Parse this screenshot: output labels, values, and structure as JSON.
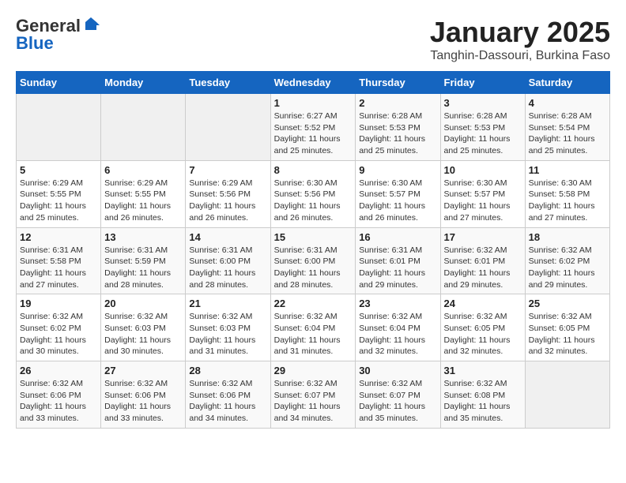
{
  "header": {
    "logo_general": "General",
    "logo_blue": "Blue",
    "month_title": "January 2025",
    "location": "Tanghin-Dassouri, Burkina Faso"
  },
  "days_of_week": [
    "Sunday",
    "Monday",
    "Tuesday",
    "Wednesday",
    "Thursday",
    "Friday",
    "Saturday"
  ],
  "weeks": [
    [
      {
        "day": "",
        "info": ""
      },
      {
        "day": "",
        "info": ""
      },
      {
        "day": "",
        "info": ""
      },
      {
        "day": "1",
        "info": "Sunrise: 6:27 AM\nSunset: 5:52 PM\nDaylight: 11 hours and 25 minutes."
      },
      {
        "day": "2",
        "info": "Sunrise: 6:28 AM\nSunset: 5:53 PM\nDaylight: 11 hours and 25 minutes."
      },
      {
        "day": "3",
        "info": "Sunrise: 6:28 AM\nSunset: 5:53 PM\nDaylight: 11 hours and 25 minutes."
      },
      {
        "day": "4",
        "info": "Sunrise: 6:28 AM\nSunset: 5:54 PM\nDaylight: 11 hours and 25 minutes."
      }
    ],
    [
      {
        "day": "5",
        "info": "Sunrise: 6:29 AM\nSunset: 5:55 PM\nDaylight: 11 hours and 25 minutes."
      },
      {
        "day": "6",
        "info": "Sunrise: 6:29 AM\nSunset: 5:55 PM\nDaylight: 11 hours and 26 minutes."
      },
      {
        "day": "7",
        "info": "Sunrise: 6:29 AM\nSunset: 5:56 PM\nDaylight: 11 hours and 26 minutes."
      },
      {
        "day": "8",
        "info": "Sunrise: 6:30 AM\nSunset: 5:56 PM\nDaylight: 11 hours and 26 minutes."
      },
      {
        "day": "9",
        "info": "Sunrise: 6:30 AM\nSunset: 5:57 PM\nDaylight: 11 hours and 26 minutes."
      },
      {
        "day": "10",
        "info": "Sunrise: 6:30 AM\nSunset: 5:57 PM\nDaylight: 11 hours and 27 minutes."
      },
      {
        "day": "11",
        "info": "Sunrise: 6:30 AM\nSunset: 5:58 PM\nDaylight: 11 hours and 27 minutes."
      }
    ],
    [
      {
        "day": "12",
        "info": "Sunrise: 6:31 AM\nSunset: 5:58 PM\nDaylight: 11 hours and 27 minutes."
      },
      {
        "day": "13",
        "info": "Sunrise: 6:31 AM\nSunset: 5:59 PM\nDaylight: 11 hours and 28 minutes."
      },
      {
        "day": "14",
        "info": "Sunrise: 6:31 AM\nSunset: 6:00 PM\nDaylight: 11 hours and 28 minutes."
      },
      {
        "day": "15",
        "info": "Sunrise: 6:31 AM\nSunset: 6:00 PM\nDaylight: 11 hours and 28 minutes."
      },
      {
        "day": "16",
        "info": "Sunrise: 6:31 AM\nSunset: 6:01 PM\nDaylight: 11 hours and 29 minutes."
      },
      {
        "day": "17",
        "info": "Sunrise: 6:32 AM\nSunset: 6:01 PM\nDaylight: 11 hours and 29 minutes."
      },
      {
        "day": "18",
        "info": "Sunrise: 6:32 AM\nSunset: 6:02 PM\nDaylight: 11 hours and 29 minutes."
      }
    ],
    [
      {
        "day": "19",
        "info": "Sunrise: 6:32 AM\nSunset: 6:02 PM\nDaylight: 11 hours and 30 minutes."
      },
      {
        "day": "20",
        "info": "Sunrise: 6:32 AM\nSunset: 6:03 PM\nDaylight: 11 hours and 30 minutes."
      },
      {
        "day": "21",
        "info": "Sunrise: 6:32 AM\nSunset: 6:03 PM\nDaylight: 11 hours and 31 minutes."
      },
      {
        "day": "22",
        "info": "Sunrise: 6:32 AM\nSunset: 6:04 PM\nDaylight: 11 hours and 31 minutes."
      },
      {
        "day": "23",
        "info": "Sunrise: 6:32 AM\nSunset: 6:04 PM\nDaylight: 11 hours and 32 minutes."
      },
      {
        "day": "24",
        "info": "Sunrise: 6:32 AM\nSunset: 6:05 PM\nDaylight: 11 hours and 32 minutes."
      },
      {
        "day": "25",
        "info": "Sunrise: 6:32 AM\nSunset: 6:05 PM\nDaylight: 11 hours and 32 minutes."
      }
    ],
    [
      {
        "day": "26",
        "info": "Sunrise: 6:32 AM\nSunset: 6:06 PM\nDaylight: 11 hours and 33 minutes."
      },
      {
        "day": "27",
        "info": "Sunrise: 6:32 AM\nSunset: 6:06 PM\nDaylight: 11 hours and 33 minutes."
      },
      {
        "day": "28",
        "info": "Sunrise: 6:32 AM\nSunset: 6:06 PM\nDaylight: 11 hours and 34 minutes."
      },
      {
        "day": "29",
        "info": "Sunrise: 6:32 AM\nSunset: 6:07 PM\nDaylight: 11 hours and 34 minutes."
      },
      {
        "day": "30",
        "info": "Sunrise: 6:32 AM\nSunset: 6:07 PM\nDaylight: 11 hours and 35 minutes."
      },
      {
        "day": "31",
        "info": "Sunrise: 6:32 AM\nSunset: 6:08 PM\nDaylight: 11 hours and 35 minutes."
      },
      {
        "day": "",
        "info": ""
      }
    ]
  ]
}
